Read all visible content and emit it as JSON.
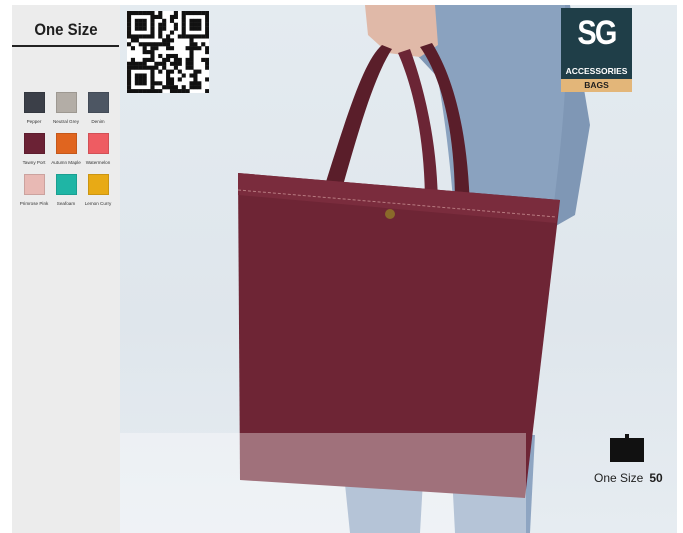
{
  "sidebar": {
    "size_title": "One Size",
    "swatches": [
      {
        "label": "Pepper",
        "color": "#3b3f48"
      },
      {
        "label": "Neutral Grey",
        "color": "#b3ada6"
      },
      {
        "label": "Denim",
        "color": "#4d5663"
      },
      {
        "label": "Tawny Port",
        "color": "#6b2235"
      },
      {
        "label": "Autumn Maple",
        "color": "#e0651f"
      },
      {
        "label": "Watermelon",
        "color": "#ee5c62"
      },
      {
        "label": "Primrose Pink",
        "color": "#e8b9b4"
      },
      {
        "label": "Seafoam",
        "color": "#1fb5a5"
      },
      {
        "label": "Lemon Curry",
        "color": "#e8aa15"
      }
    ]
  },
  "qr_code": {
    "icon": "qr-code-icon"
  },
  "brand": {
    "logo_text": "SG",
    "category": "ACCESSORIES",
    "subcategory": "BAGS",
    "colors": {
      "panel": "#1f3e48",
      "tab": "#e3b679"
    }
  },
  "product_image": {
    "icon": "tote-bag-photo",
    "bag_color": "#6e2535"
  },
  "size_info": {
    "label": "One Size",
    "quantity": "50",
    "icon": "bag-silhouette-icon"
  }
}
